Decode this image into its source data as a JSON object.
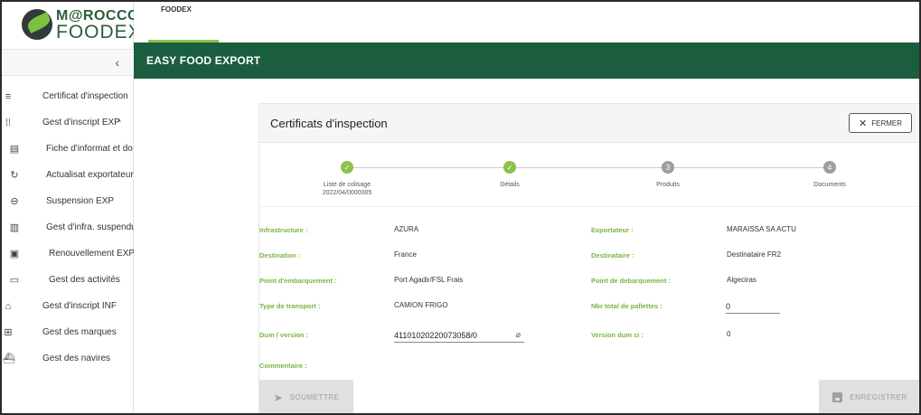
{
  "brand": {
    "logo_line1": "M@ROCCO",
    "logo_line2": "FOODEX"
  },
  "topbar": {
    "tab_label": "FOODEX",
    "header_title": "EASY FOOD EXPORT",
    "accent_color": "#1b5e3f"
  },
  "sidebar": {
    "collapse_icon": "‹",
    "items": [
      {
        "label": "Certificat d'inspection",
        "icon": "list-check-icon"
      },
      {
        "label": "Gest d'inscript EXP",
        "icon": "apps-grid-icon"
      },
      {
        "label": "Fiche d'informat et do",
        "icon": "clipboard-icon"
      },
      {
        "label": "Actualisat exportateur",
        "icon": "refresh-icon"
      },
      {
        "label": "Suspension EXP",
        "icon": "minus-circle-icon"
      },
      {
        "label": "Gest d'infra. suspendu",
        "icon": "building-icon"
      },
      {
        "label": "Renouvellement EXP",
        "icon": "account-box-icon"
      },
      {
        "label": "Gest des activités",
        "icon": "ticket-icon"
      },
      {
        "label": "Gest d'inscript INF",
        "icon": "bank-icon"
      },
      {
        "label": "Gest des marques",
        "icon": "add-box-icon"
      },
      {
        "label": "Gest des navires",
        "icon": "ship-icon"
      }
    ]
  },
  "card": {
    "title": "Certificats d'inspection",
    "close_label": "FERMER",
    "steps": [
      {
        "number": "✓",
        "label": "Liste de colisage",
        "sublabel": "2022/04/0000005",
        "status": "done"
      },
      {
        "number": "✓",
        "label": "Détails",
        "sublabel": "",
        "status": "done"
      },
      {
        "number": "3",
        "label": "Produits",
        "sublabel": "",
        "status": "todo"
      },
      {
        "number": "4",
        "label": "Documents",
        "sublabel": "",
        "status": "todo"
      }
    ],
    "fields": {
      "infrastructure": {
        "label": "Infrastructure :",
        "value": "AZURA"
      },
      "exportateur": {
        "label": "Exportateur :",
        "value": "MARAISSA SA ACTU"
      },
      "destination": {
        "label": "Destination :",
        "value": "France"
      },
      "destinataire": {
        "label": "Destinataire :",
        "value": "Destinataire FR2"
      },
      "embarquement": {
        "label": "Point d'embarquement :",
        "value": "Port Agadir/FSL Frais"
      },
      "debarquement": {
        "label": "Point de debarquement :",
        "value": "Algeciras"
      },
      "transport": {
        "label": "Type de transport :",
        "value": "CAMION FRIGO"
      },
      "palettes": {
        "label": "Nbr total de pallettes :",
        "value": "0"
      },
      "dum": {
        "label": "Dum / version :",
        "value": "41101020220073058/0"
      },
      "version_dum_ci": {
        "label": "Version dum ci :",
        "value": "0"
      },
      "commentaire": {
        "label": "Commentaire :",
        "value": ""
      }
    },
    "submit_label": "SOUMETTRE",
    "save_label": "ENREGISTRER"
  },
  "colors": {
    "green_label": "#7cb342",
    "step_done": "#8bc34a",
    "step_todo": "#9e9e9e"
  }
}
